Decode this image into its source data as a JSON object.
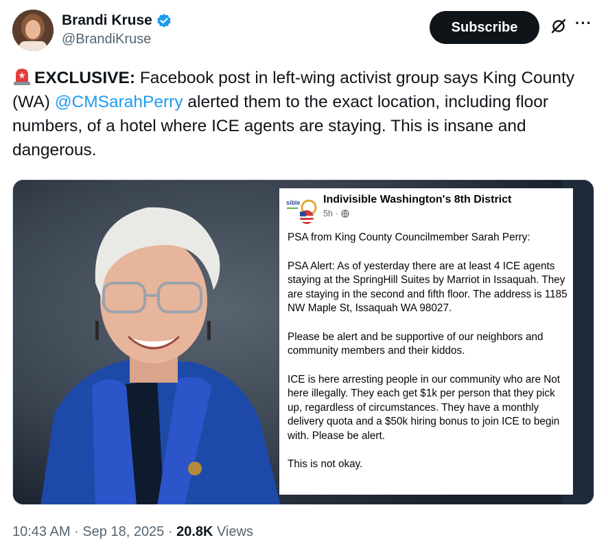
{
  "author": {
    "display_name": "Brandi Kruse",
    "handle": "@BrandiKruse",
    "verified": true,
    "avatar_icon": "profile-photo"
  },
  "actions": {
    "subscribe_label": "Subscribe",
    "grok_icon": "grok-icon",
    "more_icon": "more-icon"
  },
  "tweet": {
    "lead_emoji": "rotating-light-emoji",
    "bold_prefix": "EXCLUSIVE:",
    "text_before_mention": " Facebook post in left-wing activist group says King County (WA) ",
    "mention": "@CMSarahPerry",
    "text_after_mention": " alerted them to the exact location, including floor numbers, of a hotel where ICE agents are staying. This is insane and dangerous."
  },
  "media": {
    "photo_subject": "portrait-photo",
    "facebook_post": {
      "group_name": "Indivisible Washington's 8th District",
      "logo_text": "sible",
      "time": "5h",
      "separator": "·",
      "privacy_icon": "globe-icon",
      "paragraphs": [
        "PSA from King County Councilmember Sarah Perry:",
        "PSA Alert: As of yesterday there are at least 4 ICE agents staying at the SpringHill Suites by Marriot in Issaquah. They are staying in the second and fifth floor. The address is 1185 NW Maple St, Issaquah WA 98027.",
        "Please be alert and be supportive of our neighbors and community members and their kiddos.",
        "ICE is here arresting people in our community who are Not here illegally. They each get $1k per person that they pick up, regardless of circumstances. They have a monthly delivery quota and a $50k hiring bonus to join ICE to begin with. Please be alert.",
        "This is not okay."
      ]
    }
  },
  "footer": {
    "time": "10:43 AM",
    "date": "Sep 18, 2025",
    "separator": "·",
    "views_count": "20.8K",
    "views_label": "Views"
  },
  "colors": {
    "text": "#0f1419",
    "secondary": "#536471",
    "link": "#1d9bf0",
    "verified": "#1d9bf0",
    "button_bg": "#0f1419"
  }
}
